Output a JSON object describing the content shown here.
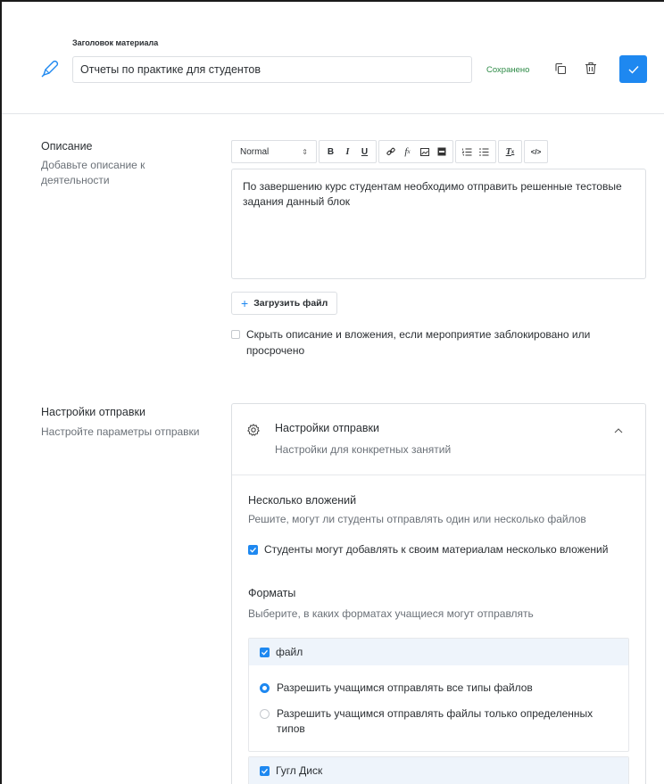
{
  "header": {
    "title_label": "Заголовок материала",
    "title_value": "Отчеты по практике для студентов",
    "saved_status": "Сохранено",
    "icons": {
      "edit": "pen-icon",
      "copy": "copy-icon",
      "delete": "trash-icon",
      "confirm": "check-icon"
    },
    "accent_color": "#1e88f0"
  },
  "description": {
    "title": "Описание",
    "subtitle": "Добавьте описание к деятельности",
    "toolbar": {
      "format_select": "Normal",
      "buttons": [
        "bold",
        "italic",
        "underline",
        "link",
        "formula",
        "image",
        "video",
        "ordered-list",
        "bullet-list",
        "clear-format",
        "code"
      ]
    },
    "editor_text": "По завершению курс студентам необходимо отправить решенные тестовые задания данный блок",
    "upload_label": "Загрузить файл",
    "hide_checkbox_label": "Скрыть описание и вложения, если мероприятие заблокировано или просрочено",
    "hide_checked": false
  },
  "submission": {
    "title": "Настройки отправки",
    "subtitle": "Настройте параметры отправки",
    "card": {
      "title": "Настройки отправки",
      "subtitle": "Настройки для конкретных занятий",
      "multiple": {
        "title": "Несколько вложений",
        "subtitle": "Решите, могут ли студенты отправлять один или несколько файлов",
        "checkbox_label": "Студенты могут добавлять к своим материалам несколько вложений",
        "checked": true
      },
      "formats": {
        "title": "Форматы",
        "subtitle": "Выберите, в каких форматах учащиеся могут отправлять",
        "file": {
          "label": "файл",
          "checked": true,
          "options": [
            {
              "label": "Разрешить учащимся отправлять все типы файлов",
              "selected": true
            },
            {
              "label": "Разрешить учащимся отправлять файлы только определенных типов",
              "selected": false
            }
          ]
        },
        "google_drive": {
          "label": "Гугл Диск",
          "checked": true
        }
      }
    }
  }
}
